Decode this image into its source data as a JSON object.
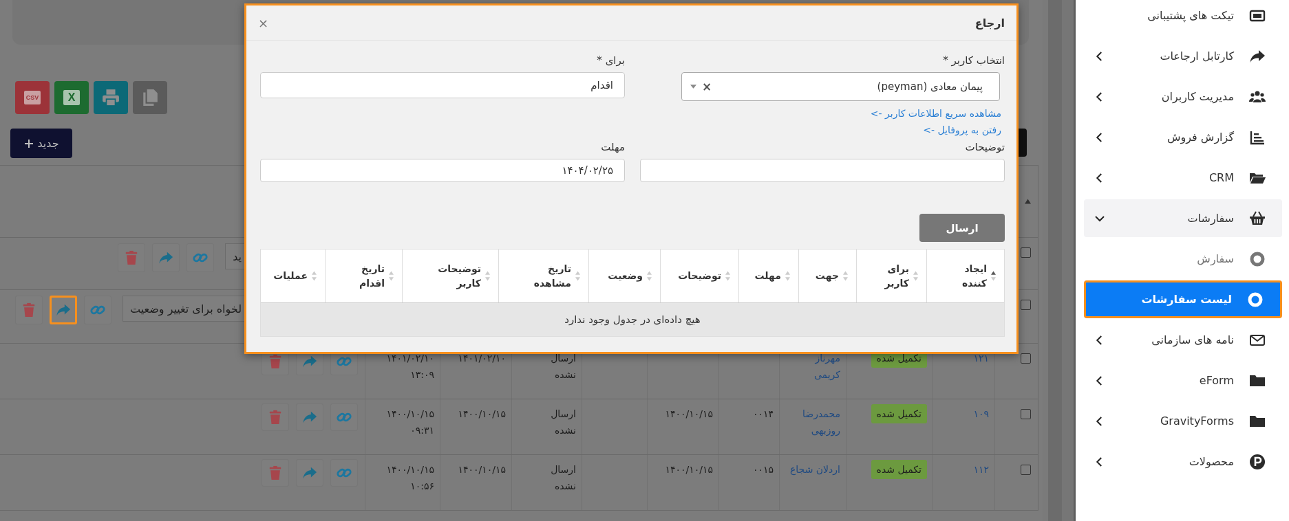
{
  "background": {
    "export_buttons": [
      {
        "kind": "copy"
      },
      {
        "kind": "print"
      },
      {
        "kind": "excel",
        "label": "X"
      },
      {
        "kind": "csv",
        "label": "CSV"
      }
    ],
    "new_button": {
      "label": "جدید"
    },
    "table": {
      "sort_indicator": true,
      "rows": [
        {
          "kind": "edit",
          "checked": false,
          "field_text": "ید",
          "forward_highlighted": false
        },
        {
          "kind": "edit",
          "checked": false,
          "field_text": "لخواه برای تغییر وضعیت",
          "forward_highlighted": true
        },
        {
          "kind": "data",
          "checked": false,
          "forward_highlighted": false,
          "column_2": "۱۲۱",
          "column_3": "تکمیل شده",
          "column_4": "مهرناز کریمی",
          "column_8": "ارسال نشده",
          "column_9": "۱۴۰۱/۰۲/۱۰",
          "column_10": "۱۴۰۱/۰۲/۱۰ ۱۳:۰۹"
        },
        {
          "kind": "data",
          "checked": false,
          "forward_highlighted": false,
          "column_2": "۱۰۹",
          "column_3": "تکمیل شده",
          "column_4": "محمدرضا روزبهی",
          "column_5": "۰۰۱۴",
          "column_6": "۱۴۰۰/۱۰/۱۵",
          "column_8": "ارسال نشده",
          "column_9": "۱۴۰۰/۱۰/۱۵",
          "column_10": "۱۴۰۰/۱۰/۱۵ ۰۹:۳۱"
        },
        {
          "kind": "data",
          "checked": false,
          "forward_highlighted": false,
          "column_2": "۱۱۲",
          "column_3": "تکمیل شده",
          "column_4": "اردلان شجاع",
          "column_5": "۰۰۱۵",
          "column_6": "۱۴۰۰/۱۰/۱۵",
          "column_8": "ارسال نشده",
          "column_9": "۱۴۰۰/۱۰/۱۵",
          "column_10": "۱۴۰۰/۱۰/۱۵ ۱۰:۵۶"
        }
      ]
    }
  },
  "modal": {
    "title": "ارجاع",
    "close": "×",
    "highlighted": true,
    "user_field": {
      "label": "انتخاب کاربر *",
      "value": "پیمان معادی (peyman)",
      "clear": "×"
    },
    "links": [
      "مشاهده سریع اطلاعات کاربر ->",
      "رفتن به پروفایل ->"
    ],
    "for_field": {
      "label": "برای *",
      "value": "اقدام"
    },
    "notes_field": {
      "label": "توضیحات"
    },
    "deadline_field": {
      "label": "مهلت",
      "value": "۱۴۰۴/۰۲/۲۵"
    },
    "send_button": "ارسال",
    "table": {
      "columns": [
        {
          "label": "ایجاد کننده",
          "sorted": true
        },
        {
          "label": "برای کاربر",
          "sorted": false
        },
        {
          "label": "جهت",
          "sorted": false
        },
        {
          "label": "مهلت",
          "sorted": false
        },
        {
          "label": "توضیحات",
          "sorted": false
        },
        {
          "label": "وضعیت",
          "sorted": false
        },
        {
          "label": "تاریخ مشاهده",
          "sorted": false
        },
        {
          "label": "توضیحات کاربر",
          "sorted": false
        },
        {
          "label": "تاریخ اقدام",
          "sorted": false
        },
        {
          "label": "عملیات",
          "sorted": false
        }
      ],
      "empty_message": "هیچ داده‌ای در جدول وجود ندارد"
    }
  },
  "sidebar": {
    "items": [
      {
        "label": "تیکت های پشتیبانی",
        "kind": "link",
        "selected": false
      },
      {
        "label": "کارتابل ارجاعات",
        "kind": "group",
        "expanded": false,
        "selected": false
      },
      {
        "label": "مدیریت کاربران",
        "kind": "group",
        "expanded": false,
        "selected": false
      },
      {
        "label": "گزارش فروش",
        "kind": "group",
        "expanded": false,
        "selected": false
      },
      {
        "label": "CRM",
        "kind": "group",
        "expanded": false,
        "selected": false
      },
      {
        "label": "سفارشات",
        "kind": "group",
        "expanded": true,
        "selected": false,
        "children": [
          {
            "label": "سفارش",
            "selected": false,
            "highlighted": false
          },
          {
            "label": "لیست سفارشات",
            "selected": true,
            "highlighted": true
          }
        ]
      },
      {
        "label": "نامه های سازمانی",
        "kind": "group",
        "expanded": false,
        "selected": false
      },
      {
        "label": "eForm",
        "kind": "group",
        "expanded": false,
        "selected": false
      },
      {
        "label": "GravityForms",
        "kind": "group",
        "expanded": false,
        "selected": false
      },
      {
        "label": "محصولات",
        "kind": "group",
        "expanded": false,
        "selected": false
      }
    ]
  }
}
